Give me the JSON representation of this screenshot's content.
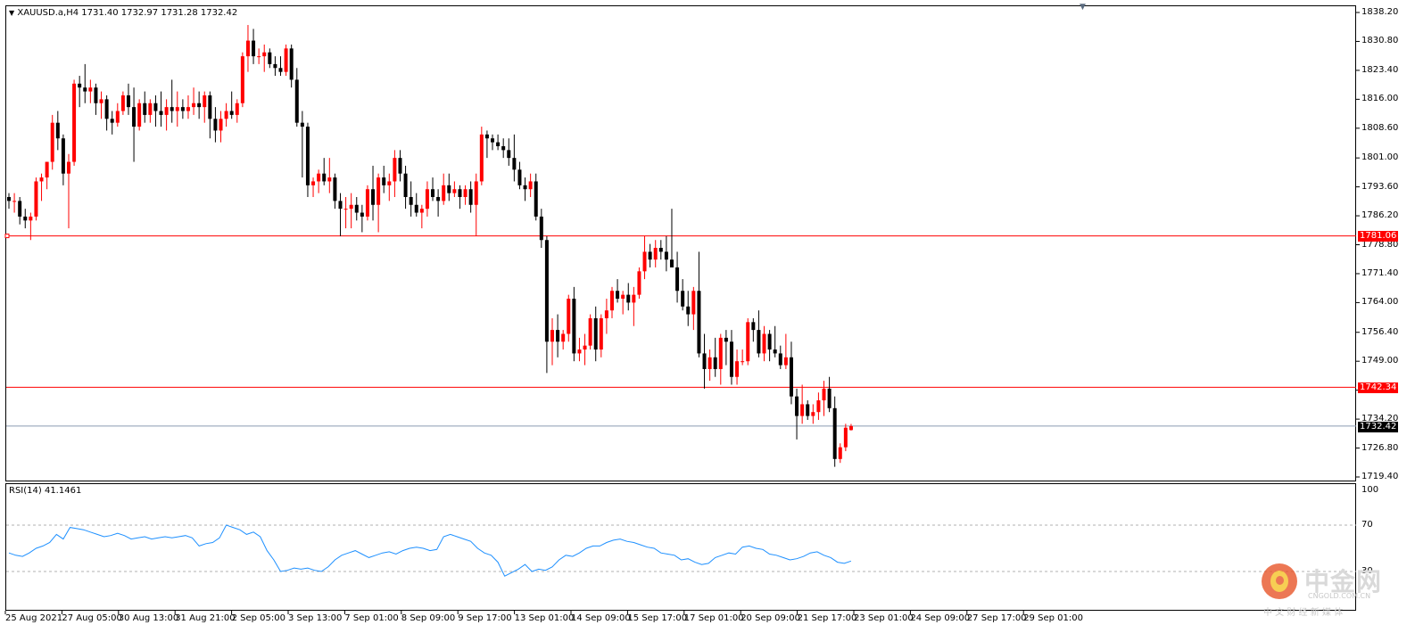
{
  "header": {
    "symbol_info": "XAUUSD.a,H4  1731.40 1732.97 1731.28 1732.42",
    "menu_icon": "triangle-down-icon"
  },
  "rsi_header": "RSI(14) 41.1461",
  "price_axis": [
    "1838.20",
    "1830.80",
    "1823.40",
    "1816.00",
    "1808.60",
    "1801.00",
    "1793.60",
    "1786.20",
    "1778.80",
    "1771.40",
    "1764.00",
    "1756.40",
    "1749.00",
    "1741.60",
    "1734.20",
    "1726.80",
    "1719.40"
  ],
  "rsi_axis": [
    "100",
    "70",
    "30"
  ],
  "levels": {
    "upper": "1781.06",
    "lower": "1742.34",
    "current": "1732.42",
    "level_color": "#ff0000",
    "current_color": "#000000"
  },
  "date_axis": [
    "25 Aug 2021",
    "27 Aug 05:00",
    "30 Aug 13:00",
    "31 Aug 21:00",
    "2 Sep 05:00",
    "3 Sep 13:00",
    "7 Sep 01:00",
    "8 Sep 09:00",
    "9 Sep 17:00",
    "13 Sep 01:00",
    "14 Sep 09:00",
    "15 Sep 17:00",
    "17 Sep 01:00",
    "20 Sep 09:00",
    "21 Sep 17:00",
    "23 Sep 01:00",
    "24 Sep 09:00",
    "27 Sep 17:00",
    "29 Sep 01:00"
  ],
  "watermark": {
    "brand": "中金网",
    "url": "CNGOLD.COM.CN",
    "slogan": "中 文 财 经 新 媒 体"
  },
  "colors": {
    "bull": "#ff0000",
    "bear": "#000000",
    "rsi_line": "#1e90ff",
    "grid_dash": "#b0b0b0"
  },
  "chart_data": {
    "type": "candlestick",
    "symbol": "XAUUSD.a",
    "timeframe": "H4",
    "ylim": [
      1719.4,
      1838.2
    ],
    "candles": [
      [
        1791,
        1792,
        1788,
        1790
      ],
      [
        1790,
        1792,
        1787,
        1790
      ],
      [
        1790,
        1791,
        1784,
        1786
      ],
      [
        1786,
        1788,
        1783,
        1785
      ],
      [
        1785,
        1787,
        1780,
        1786
      ],
      [
        1786,
        1796,
        1785,
        1795
      ],
      [
        1795,
        1797,
        1790,
        1796
      ],
      [
        1796,
        1800,
        1793,
        1800
      ],
      [
        1800,
        1812,
        1798,
        1810
      ],
      [
        1810,
        1813,
        1803,
        1806
      ],
      [
        1806,
        1807,
        1794,
        1797
      ],
      [
        1797,
        1802,
        1783,
        1800
      ],
      [
        1800,
        1821,
        1799,
        1820
      ],
      [
        1820,
        1822,
        1814,
        1819
      ],
      [
        1819,
        1825,
        1815,
        1818
      ],
      [
        1818,
        1821,
        1815,
        1819
      ],
      [
        1819,
        1820,
        1812,
        1815
      ],
      [
        1815,
        1818,
        1811,
        1816
      ],
      [
        1816,
        1817,
        1808,
        1811
      ],
      [
        1811,
        1813,
        1807,
        1810
      ],
      [
        1810,
        1815,
        1809,
        1813
      ],
      [
        1813,
        1818,
        1812,
        1817
      ],
      [
        1817,
        1820,
        1812,
        1814
      ],
      [
        1814,
        1819,
        1800,
        1809
      ],
      [
        1809,
        1816,
        1808,
        1815
      ],
      [
        1815,
        1818,
        1810,
        1812
      ],
      [
        1812,
        1816,
        1810,
        1815
      ],
      [
        1815,
        1817,
        1809,
        1813
      ],
      [
        1813,
        1818,
        1809,
        1812
      ],
      [
        1812,
        1816,
        1808,
        1814
      ],
      [
        1814,
        1821,
        1810,
        1813
      ],
      [
        1813,
        1818,
        1809,
        1814
      ],
      [
        1814,
        1816,
        1811,
        1813
      ],
      [
        1813,
        1817,
        1811,
        1814
      ],
      [
        1814,
        1819,
        1812,
        1815
      ],
      [
        1815,
        1818,
        1811,
        1814
      ],
      [
        1814,
        1818,
        1810,
        1817
      ],
      [
        1817,
        1818,
        1806,
        1811
      ],
      [
        1811,
        1814,
        1805,
        1808
      ],
      [
        1808,
        1813,
        1805,
        1811
      ],
      [
        1811,
        1815,
        1809,
        1813
      ],
      [
        1813,
        1818,
        1811,
        1812
      ],
      [
        1812,
        1816,
        1810,
        1815
      ],
      [
        1815,
        1828,
        1814,
        1827
      ],
      [
        1827,
        1835,
        1823,
        1831
      ],
      [
        1831,
        1834,
        1825,
        1827
      ],
      [
        1827,
        1829,
        1825,
        1827
      ],
      [
        1827,
        1830,
        1823,
        1828
      ],
      [
        1828,
        1829,
        1824,
        1825
      ],
      [
        1825,
        1827,
        1822,
        1824
      ],
      [
        1824,
        1827,
        1822,
        1823
      ],
      [
        1823,
        1830,
        1822,
        1829
      ],
      [
        1829,
        1830,
        1819,
        1821
      ],
      [
        1821,
        1824,
        1809,
        1810
      ],
      [
        1810,
        1813,
        1796,
        1809
      ],
      [
        1809,
        1810,
        1791,
        1794
      ],
      [
        1794,
        1796,
        1791,
        1795
      ],
      [
        1795,
        1798,
        1792,
        1797
      ],
      [
        1797,
        1801,
        1794,
        1795
      ],
      [
        1795,
        1801,
        1792,
        1796
      ],
      [
        1796,
        1797,
        1788,
        1790
      ],
      [
        1790,
        1792,
        1781,
        1788
      ],
      [
        1788,
        1791,
        1783,
        1788
      ],
      [
        1788,
        1792,
        1783,
        1789
      ],
      [
        1789,
        1791,
        1785,
        1787
      ],
      [
        1787,
        1789,
        1782,
        1786
      ],
      [
        1786,
        1794,
        1785,
        1793
      ],
      [
        1793,
        1799,
        1785,
        1789
      ],
      [
        1789,
        1797,
        1782,
        1796
      ],
      [
        1796,
        1799,
        1792,
        1794
      ],
      [
        1794,
        1797,
        1790,
        1795
      ],
      [
        1795,
        1803,
        1791,
        1801
      ],
      [
        1801,
        1803,
        1795,
        1797
      ],
      [
        1797,
        1799,
        1788,
        1791
      ],
      [
        1791,
        1795,
        1786,
        1789
      ],
      [
        1789,
        1792,
        1786,
        1787
      ],
      [
        1787,
        1789,
        1783,
        1788
      ],
      [
        1788,
        1795,
        1786,
        1793
      ],
      [
        1793,
        1796,
        1790,
        1791
      ],
      [
        1791,
        1793,
        1786,
        1790
      ],
      [
        1790,
        1797,
        1789,
        1794
      ],
      [
        1794,
        1797,
        1790,
        1792
      ],
      [
        1792,
        1795,
        1791,
        1793
      ],
      [
        1793,
        1794,
        1788,
        1791
      ],
      [
        1791,
        1794,
        1789,
        1793
      ],
      [
        1793,
        1795,
        1787,
        1789
      ],
      [
        1789,
        1797,
        1781,
        1795
      ],
      [
        1795,
        1809,
        1794,
        1807
      ],
      [
        1807,
        1808,
        1801,
        1806
      ],
      [
        1806,
        1807,
        1803,
        1805
      ],
      [
        1805,
        1807,
        1803,
        1804
      ],
      [
        1804,
        1806,
        1801,
        1803
      ],
      [
        1803,
        1806,
        1799,
        1801
      ],
      [
        1801,
        1807,
        1795,
        1798
      ],
      [
        1798,
        1800,
        1793,
        1794
      ],
      [
        1794,
        1796,
        1790,
        1793
      ],
      [
        1793,
        1797,
        1791,
        1795
      ],
      [
        1795,
        1797,
        1785,
        1786
      ],
      [
        1786,
        1788,
        1778,
        1780
      ],
      [
        1780,
        1781,
        1746,
        1754
      ],
      [
        1754,
        1760,
        1748,
        1757
      ],
      [
        1757,
        1761,
        1750,
        1754
      ],
      [
        1754,
        1757,
        1752,
        1756
      ],
      [
        1756,
        1766,
        1754,
        1765
      ],
      [
        1765,
        1768,
        1749,
        1751
      ],
      [
        1751,
        1755,
        1749,
        1752
      ],
      [
        1752,
        1756,
        1748,
        1753
      ],
      [
        1753,
        1761,
        1752,
        1760
      ],
      [
        1760,
        1763,
        1749,
        1752
      ],
      [
        1752,
        1761,
        1750,
        1760
      ],
      [
        1760,
        1765,
        1756,
        1762
      ],
      [
        1762,
        1768,
        1760,
        1767
      ],
      [
        1767,
        1770,
        1764,
        1765
      ],
      [
        1765,
        1767,
        1761,
        1766
      ],
      [
        1766,
        1769,
        1762,
        1764
      ],
      [
        1764,
        1768,
        1758,
        1766
      ],
      [
        1766,
        1773,
        1765,
        1772
      ],
      [
        1772,
        1781,
        1770,
        1777
      ],
      [
        1777,
        1779,
        1773,
        1775
      ],
      [
        1775,
        1780,
        1773,
        1778
      ],
      [
        1778,
        1780,
        1775,
        1777
      ],
      [
        1777,
        1781,
        1772,
        1775
      ],
      [
        1775,
        1788,
        1774,
        1773
      ],
      [
        1773,
        1777,
        1764,
        1767
      ],
      [
        1767,
        1770,
        1762,
        1763
      ],
      [
        1763,
        1767,
        1758,
        1761
      ],
      [
        1761,
        1768,
        1757,
        1767
      ],
      [
        1767,
        1777,
        1750,
        1751
      ],
      [
        1751,
        1756,
        1742,
        1747
      ],
      [
        1747,
        1752,
        1744,
        1750
      ],
      [
        1750,
        1755,
        1745,
        1747
      ],
      [
        1747,
        1756,
        1743,
        1755
      ],
      [
        1755,
        1757,
        1748,
        1754
      ],
      [
        1754,
        1757,
        1743,
        1745
      ],
      [
        1745,
        1752,
        1743,
        1749
      ],
      [
        1749,
        1752,
        1748,
        1749
      ],
      [
        1749,
        1760,
        1748,
        1759
      ],
      [
        1759,
        1760,
        1754,
        1757
      ],
      [
        1757,
        1762,
        1750,
        1751
      ],
      [
        1751,
        1758,
        1749,
        1756
      ],
      [
        1756,
        1757,
        1749,
        1752
      ],
      [
        1752,
        1758,
        1750,
        1751
      ],
      [
        1751,
        1753,
        1747,
        1748
      ],
      [
        1748,
        1756,
        1747,
        1750
      ],
      [
        1750,
        1754,
        1738,
        1740
      ],
      [
        1740,
        1742,
        1729,
        1735
      ],
      [
        1735,
        1743,
        1733,
        1738
      ],
      [
        1738,
        1739,
        1734,
        1735
      ],
      [
        1735,
        1738,
        1733,
        1736
      ],
      [
        1736,
        1741,
        1734,
        1739
      ],
      [
        1739,
        1744,
        1735,
        1742
      ],
      [
        1742,
        1745,
        1736,
        1737
      ],
      [
        1737,
        1740,
        1722,
        1724
      ],
      [
        1724,
        1728,
        1723,
        1727
      ],
      [
        1727,
        1733,
        1726,
        1732
      ],
      [
        1731.4,
        1732.97,
        1731.28,
        1732.42
      ]
    ]
  },
  "rsi_data": {
    "type": "line",
    "ylim": [
      0,
      100
    ],
    "levels": [
      70,
      30
    ],
    "values": [
      46,
      44,
      43,
      46,
      50,
      52,
      55,
      62,
      58,
      68,
      67,
      66,
      64,
      62,
      60,
      61,
      63,
      61,
      58,
      59,
      60,
      58,
      59,
      60,
      59,
      60,
      61,
      59,
      52,
      54,
      55,
      59,
      70,
      68,
      66,
      62,
      64,
      60,
      48,
      40,
      30,
      31,
      33,
      32,
      33,
      31,
      30,
      34,
      40,
      44,
      46,
      48,
      45,
      42,
      44,
      46,
      47,
      45,
      48,
      50,
      51,
      50,
      48,
      49,
      60,
      62,
      60,
      58,
      56,
      50,
      46,
      44,
      38,
      26,
      29,
      32,
      36,
      30,
      32,
      31,
      34,
      40,
      44,
      43,
      46,
      50,
      52,
      52,
      55,
      57,
      58,
      56,
      55,
      53,
      51,
      50,
      46,
      45,
      44,
      40,
      41,
      38,
      36,
      37,
      42,
      44,
      46,
      45,
      51,
      52,
      50,
      49,
      45,
      44,
      42,
      40,
      41,
      43,
      46,
      47,
      44,
      42,
      38,
      37,
      39
    ],
    "title": "RSI(14)",
    "current": 41.1461
  }
}
